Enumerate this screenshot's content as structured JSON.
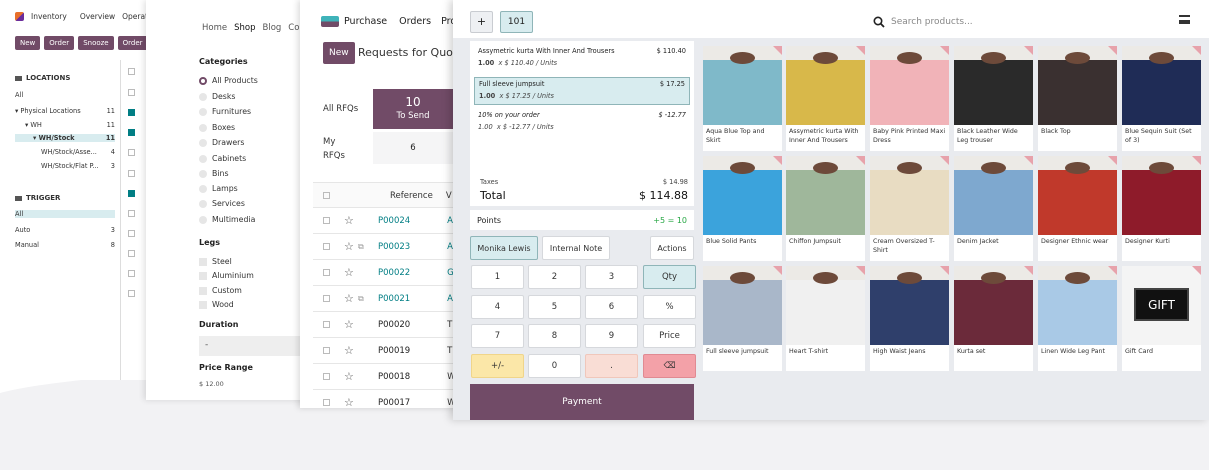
{
  "inventory": {
    "app_title": "Inventory",
    "menu": [
      "Overview",
      "Operati"
    ],
    "buttons": [
      "New",
      "Order",
      "Snooze",
      "Order"
    ],
    "locations_header": "LOCATIONS",
    "locations": [
      {
        "label": "All",
        "count": ""
      },
      {
        "label": "Physical Locations",
        "count": "11"
      },
      {
        "label": "WH",
        "count": "11"
      },
      {
        "label": "WH/Stock",
        "count": "11"
      },
      {
        "label": "WH/Stock/Asse...",
        "count": "4"
      },
      {
        "label": "WH/Stock/Flat P...",
        "count": "3"
      }
    ],
    "trigger_header": "TRIGGER",
    "triggers": [
      {
        "label": "All",
        "count": ""
      },
      {
        "label": "Auto",
        "count": "3"
      },
      {
        "label": "Manual",
        "count": "8"
      }
    ]
  },
  "shop": {
    "nav": [
      "Home",
      "Shop",
      "Blog",
      "Co"
    ],
    "categories_title": "Categories",
    "categories": [
      "All Products",
      "Desks",
      "Furnitures",
      "Boxes",
      "Drawers",
      "Cabinets",
      "Bins",
      "Lamps",
      "Services",
      "Multimedia"
    ],
    "legs_title": "Legs",
    "legs": [
      "Steel",
      "Aluminium",
      "Custom",
      "Wood"
    ],
    "duration_title": "Duration",
    "duration_value": "-",
    "price_title": "Price Range",
    "price_value": "$ 12.00"
  },
  "purchase": {
    "app_title": "Purchase",
    "menu": [
      "Orders",
      "Pro"
    ],
    "new_label": "New",
    "page_title": "Requests for Quota",
    "all_rfqs": "All RFQs",
    "to_send_count": "10",
    "to_send_label": "To Send",
    "my_rfqs": "My RFQs",
    "my_rfqs_count": "6",
    "col_reference": "Reference",
    "col_extra": "V",
    "rows": [
      {
        "ref": "P00024",
        "link": true,
        "tail": "A"
      },
      {
        "ref": "P00023",
        "link": true,
        "tail": "A"
      },
      {
        "ref": "P00022",
        "link": true,
        "tail": "G"
      },
      {
        "ref": "P00021",
        "link": true,
        "tail": "A"
      },
      {
        "ref": "P00020",
        "link": false,
        "tail": "T"
      },
      {
        "ref": "P00019",
        "link": false,
        "tail": "T"
      },
      {
        "ref": "P00018",
        "link": false,
        "tail": "W"
      },
      {
        "ref": "P00017",
        "link": false,
        "tail": "W"
      }
    ]
  },
  "pos": {
    "order_plus": "+",
    "order_number": "101",
    "search_placeholder": "Search products...",
    "lines": [
      {
        "name": "Assymetric kurta With Inner And Trousers",
        "price": "$ 110.40",
        "qty": "1.00",
        "detail": "x $ 110.40 / Units"
      },
      {
        "name": "Full sleeve jumpsuit",
        "price": "$ 17.25",
        "qty": "1.00",
        "detail": "x $ 17.25 / Units"
      },
      {
        "name": "10% on your order",
        "price": "$ -12.77",
        "qty": "1.00",
        "detail": "x $ -12.77 / Units"
      }
    ],
    "taxes_label": "Taxes",
    "taxes_value": "$ 14.98",
    "total_label": "Total",
    "total_value": "$ 114.88",
    "points_label": "Points",
    "points_value": "+5 = 10",
    "customer": "Monika Lewis",
    "internal_note": "Internal Note",
    "actions": "Actions",
    "keys": [
      "1",
      "2",
      "3",
      "Qty",
      "4",
      "5",
      "6",
      "%",
      "7",
      "8",
      "9",
      "Price",
      "+/-",
      "0",
      ".",
      "⌫"
    ],
    "payment": "Payment",
    "products": [
      {
        "name": "Aqua Blue Top and Skirt",
        "color": "#7fb9c9"
      },
      {
        "name": "Assymetric kurta With Inner And Trousers",
        "color": "#d8b84a"
      },
      {
        "name": "Baby Pink Printed Maxi Dress",
        "color": "#f1b3b8"
      },
      {
        "name": "Black Leather Wide Leg trouser",
        "color": "#2a2a2a"
      },
      {
        "name": "Black Top",
        "color": "#3a3030"
      },
      {
        "name": "Blue Sequin Suit (Set of 3)",
        "color": "#1f2c56"
      },
      {
        "name": "Blue Solid Pants",
        "color": "#3ba3dc"
      },
      {
        "name": "Chiffon Jumpsuit",
        "color": "#9fb79b"
      },
      {
        "name": "Cream Oversized T-Shirt",
        "color": "#e8dcc2"
      },
      {
        "name": "Denim Jacket",
        "color": "#7ea8cf"
      },
      {
        "name": "Designer Ethnic wear",
        "color": "#c0392b"
      },
      {
        "name": "Designer Kurti",
        "color": "#8e1b2a"
      },
      {
        "name": "Full sleeve jumpsuit",
        "color": "#a9b7c9"
      },
      {
        "name": "Heart T-shirt",
        "color": "#f0f0f0"
      },
      {
        "name": "High Waist Jeans",
        "color": "#2f3f6b"
      },
      {
        "name": "Kurta set",
        "color": "#6b2a3a"
      },
      {
        "name": "Linen Wide Leg Pant",
        "color": "#a9c9e6"
      },
      {
        "name": "Gift Card",
        "color": "#f4f4f4",
        "gift_text": "GIFT"
      }
    ]
  },
  "colors": {
    "brand": "#714B67",
    "teal": "#017e84"
  }
}
